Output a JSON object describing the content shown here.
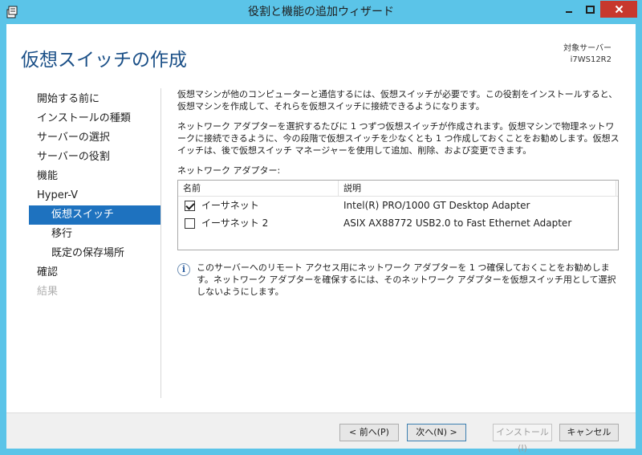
{
  "window": {
    "title": "役割と機能の追加ウィザード"
  },
  "header": {
    "page_title": "仮想スイッチの作成",
    "target_server_label": "対象サーバー",
    "target_server_name": "i7WS12R2"
  },
  "nav": {
    "items": [
      {
        "label": "開始する前に",
        "state": "normal",
        "level": 0
      },
      {
        "label": "インストールの種類",
        "state": "normal",
        "level": 0
      },
      {
        "label": "サーバーの選択",
        "state": "normal",
        "level": 0
      },
      {
        "label": "サーバーの役割",
        "state": "normal",
        "level": 0
      },
      {
        "label": "機能",
        "state": "normal",
        "level": 0
      },
      {
        "label": "Hyper-V",
        "state": "normal",
        "level": 0
      },
      {
        "label": "仮想スイッチ",
        "state": "active",
        "level": 1
      },
      {
        "label": "移行",
        "state": "normal",
        "level": 1
      },
      {
        "label": "既定の保存場所",
        "state": "normal",
        "level": 1
      },
      {
        "label": "確認",
        "state": "normal",
        "level": 0
      },
      {
        "label": "結果",
        "state": "disabled",
        "level": 0
      }
    ]
  },
  "content": {
    "paragraph1": "仮想マシンが他のコンピューターと通信するには、仮想スイッチが必要です。この役割をインストールすると、仮想マシンを作成して、それらを仮想スイッチに接続できるようになります。",
    "paragraph2": "ネットワーク アダプターを選択するたびに 1 つずつ仮想スイッチが作成されます。仮想マシンで物理ネットワークに接続できるように、今の段階で仮想スイッチを少なくとも 1 つ作成しておくことをお勧めします。仮想スイッチは、後で仮想スイッチ マネージャーを使用して追加、削除、および変更できます。",
    "adapters_label": "ネットワーク アダプター:",
    "table": {
      "columns": [
        "名前",
        "説明"
      ],
      "rows": [
        {
          "name": "イーサネット",
          "description": "Intel(R) PRO/1000 GT Desktop Adapter",
          "checked": true
        },
        {
          "name": "イーサネット 2",
          "description": "ASIX AX88772 USB2.0 to Fast Ethernet Adapter",
          "checked": false
        }
      ]
    },
    "info_text": "このサーバーへのリモート アクセス用にネットワーク アダプターを 1 つ確保しておくことをお勧めします。ネットワーク アダプターを確保するには、そのネットワーク アダプターを仮想スイッチ用として選択しないようにします。"
  },
  "footer": {
    "prev_label": "< 前へ(P)",
    "next_label": "次へ(N) >",
    "install_label": "インストール(I)",
    "cancel_label": "キャンセル"
  },
  "colors": {
    "frame": "#5bc4e8",
    "title_accent": "#1a4f87",
    "nav_active": "#1e72bf",
    "close_button": "#c7382d"
  }
}
